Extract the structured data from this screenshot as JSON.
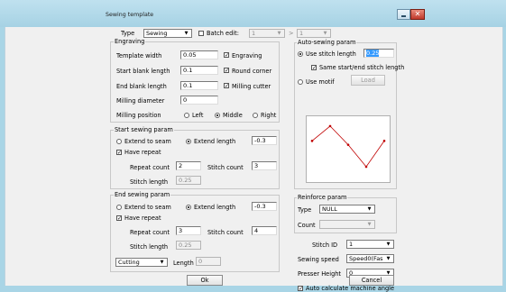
{
  "window": {
    "title": "Sewing template"
  },
  "top": {
    "type_label": "Type",
    "type_value": "Sewing",
    "batch_edit_label": "Batch edit:",
    "batch_from": "1",
    "batch_sep": ">",
    "batch_to": "1"
  },
  "engraving": {
    "legend": "Engraving",
    "template_width_label": "Template width",
    "template_width": "0.05",
    "engraving_cb": "Engraving",
    "start_blank_label": "Start blank length",
    "start_blank": "0.1",
    "round_corner_cb": "Round corner",
    "end_blank_label": "End blank length",
    "end_blank": "0.1",
    "milling_cutter_cb": "Milling cutter",
    "milling_diameter_label": "Milling diameter",
    "milling_diameter": "0",
    "milling_position_label": "Milling position",
    "pos_left": "Left",
    "pos_middle": "Middle",
    "pos_right": "Right"
  },
  "start_sewing": {
    "legend": "Start sewing param",
    "extend_to_seam": "Extend to seam",
    "extend_length": "Extend length",
    "extend_length_value": "-0.3",
    "have_repeat": "Have repeat",
    "repeat_count_label": "Repeat count",
    "repeat_count": "2",
    "stitch_count_label": "Stitch count",
    "stitch_count": "3",
    "stitch_length_label": "Stitch length",
    "stitch_length": "0.25"
  },
  "end_sewing": {
    "legend": "End sewing param",
    "extend_to_seam": "Extend to seam",
    "extend_length": "Extend length",
    "extend_length_value": "-0.3",
    "have_repeat": "Have repeat",
    "repeat_count_label": "Repeat count",
    "repeat_count": "3",
    "stitch_count_label": "Stitch count",
    "stitch_count": "4",
    "stitch_length_label": "Stitch length",
    "stitch_length": "0.25",
    "end_mode": "Cutting",
    "length_label": "Length",
    "length_value": "0"
  },
  "auto_sewing": {
    "legend": "Auto-sewing param",
    "use_stitch_length": "Use stitch length",
    "stitch_length_value": "0.25",
    "same_start_end": "Same start/end stitch length",
    "use_motif": "Use motif",
    "load_button": "Load"
  },
  "reinforce": {
    "legend": "Reinforce param",
    "type_label": "Type",
    "type_value": "NULL",
    "count_label": "Count",
    "count_value": ""
  },
  "bottom_right": {
    "stitch_id_label": "Stitch ID",
    "stitch_id": "1",
    "sewing_speed_label": "Sewing speed",
    "sewing_speed": "Speed0(Fas",
    "presser_height_label": "Presser Height",
    "presser_height": "0",
    "auto_calc_angle": "Auto calculate machine angle"
  },
  "buttons": {
    "ok": "Ok",
    "cancel": "Cancel"
  },
  "motif_plot": {
    "line_color": "#c00000",
    "points": [
      [
        0.0,
        0.35
      ],
      [
        0.25,
        0.08
      ],
      [
        0.5,
        0.42
      ],
      [
        0.75,
        0.82
      ],
      [
        1.0,
        0.35
      ]
    ]
  }
}
